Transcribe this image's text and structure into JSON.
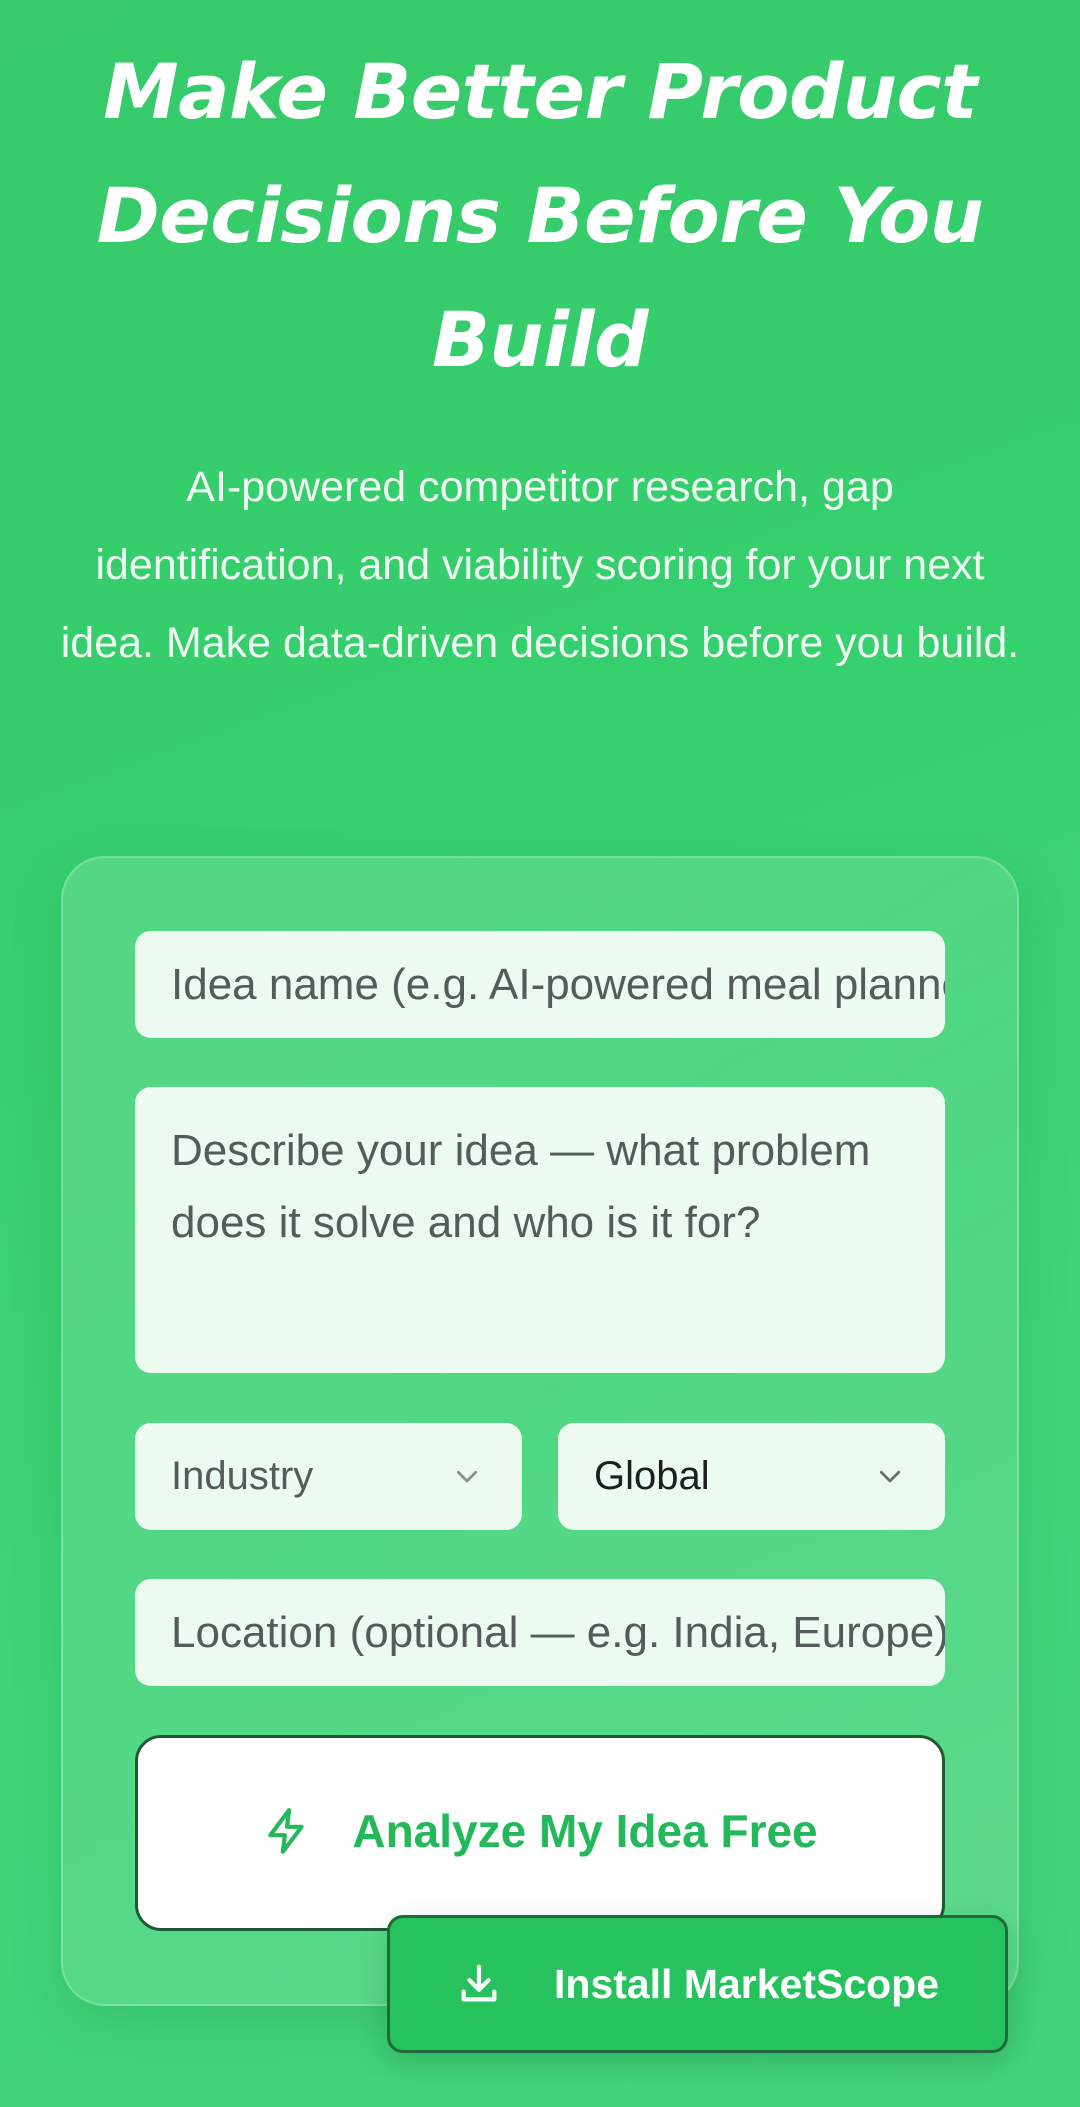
{
  "hero": {
    "title": "Make Better Product Decisions Before You Build",
    "subtitle": "AI-powered competitor research, gap identification, and viability scoring for your next idea. Make data-driven decisions before you build."
  },
  "form": {
    "idea_name_placeholder": "Idea name (e.g. AI-powered meal planner)",
    "idea_description_placeholder": "Describe your idea — what problem does it solve and who is it for?",
    "industry_select": {
      "selected": "Industry",
      "icon": "chevron-down-icon"
    },
    "region_select": {
      "selected": "Global",
      "icon": "chevron-down-icon"
    },
    "location_placeholder": "Location (optional — e.g. India, Europe)",
    "analyze_button": {
      "label": "Analyze My Idea Free",
      "icon": "lightning-icon"
    }
  },
  "install_button": {
    "label": "Install MarketScope",
    "icon": "download-icon"
  },
  "colors": {
    "background": "#36d06e",
    "accent": "#23b85a",
    "field_background": "#ecfaf0",
    "install_button": "#25c25d"
  }
}
